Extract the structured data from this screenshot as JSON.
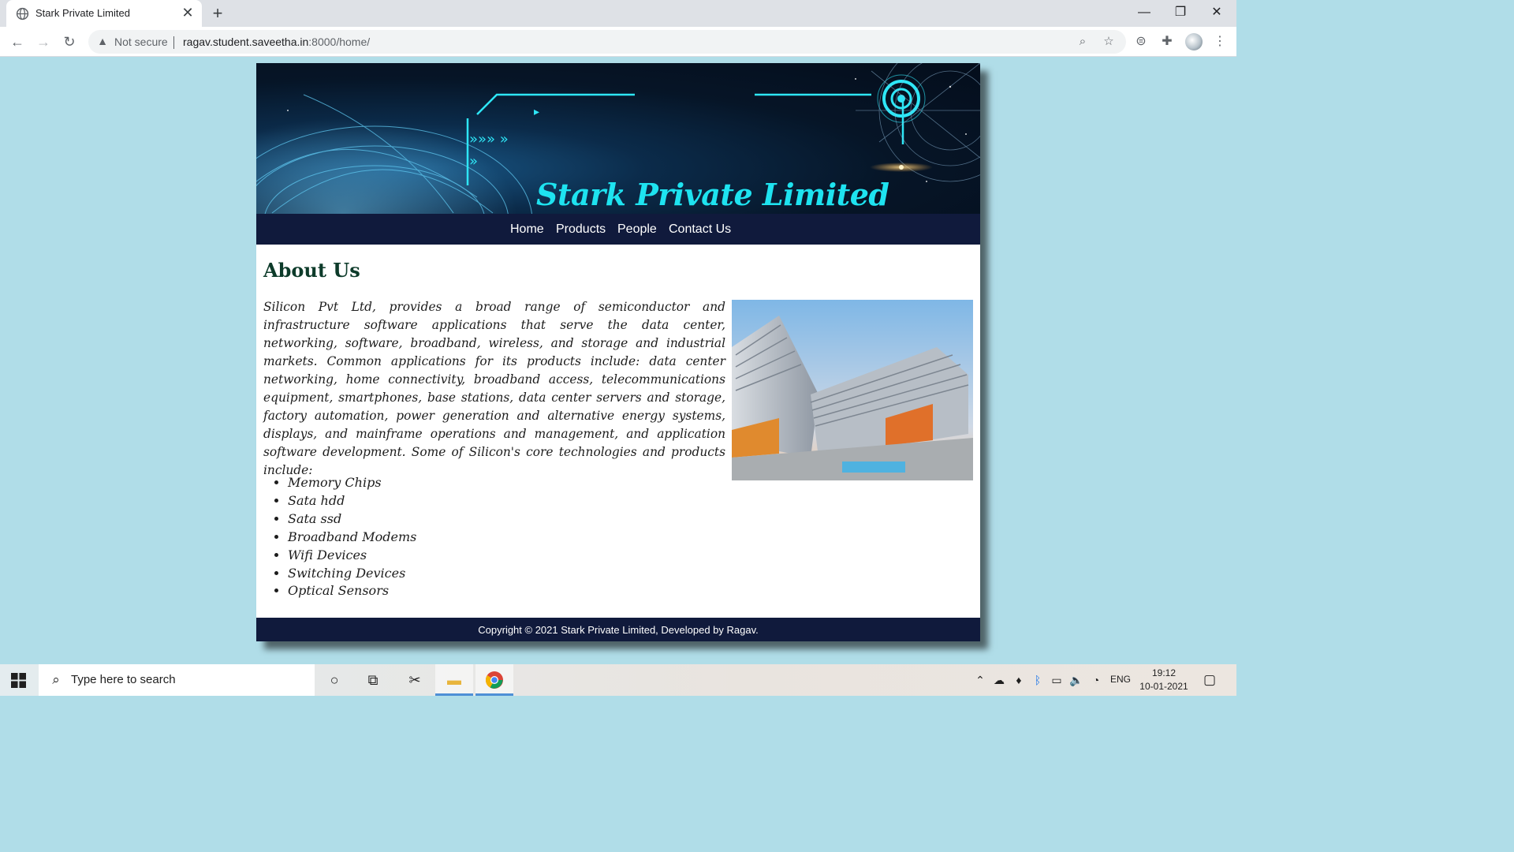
{
  "browser": {
    "tab_title": "Stark Private Limited",
    "tab_close": "✕",
    "new_tab": "+",
    "security_label": "Not secure",
    "url_host": "ragav.student.saveetha.in",
    "url_rest": ":8000/home/",
    "icons": [
      "back-arrow-icon",
      "forward-arrow-icon",
      "reload-icon",
      "warning-icon",
      "zoom-icon",
      "star-icon",
      "extension-icon",
      "puzzle-icon",
      "profile-avatar",
      "more-menu-icon"
    ],
    "window_controls": {
      "minimize": "—",
      "restore": "❐",
      "close": "✕"
    }
  },
  "site": {
    "title": "Stark Private Limited",
    "nav": [
      "Home",
      "Products",
      "People",
      "Contact Us"
    ],
    "about": {
      "heading": "About Us",
      "paragraph": "Silicon Pvt Ltd, provides a broad range of semiconductor and infrastructure software applications that serve the data center, networking, software, broadband, wireless, and storage and industrial markets. Common applications for its products include: data center networking, home connectivity, broadband access, telecommunications equipment, smartphones, base stations, data center servers and storage, factory automation, power generation and alternative energy systems, displays, and mainframe operations and management, and application software development. Some of Silicon's core technologies and products include:",
      "products": [
        "Memory Chips",
        "Sata hdd",
        "Sata ssd",
        "Broadband Modems",
        "Wifi Devices",
        "Switching Devices",
        "Optical Sensors"
      ]
    },
    "footer": "Copyright © 2021 Stark Private Limited, Developed by Ragav."
  },
  "taskbar": {
    "search_placeholder": "Type here to search",
    "language": "ENG",
    "time": "19:12",
    "date": "10-01-2021",
    "apps": [
      "cortana-icon",
      "task-view-icon",
      "snip-sketch-icon",
      "file-explorer-icon",
      "chrome-icon"
    ]
  },
  "colors": {
    "page_bg": "#b0dde8",
    "nav_bg": "#101a3c",
    "title_cyan": "#1ee3f0",
    "heading_green": "#0d3b2a"
  }
}
